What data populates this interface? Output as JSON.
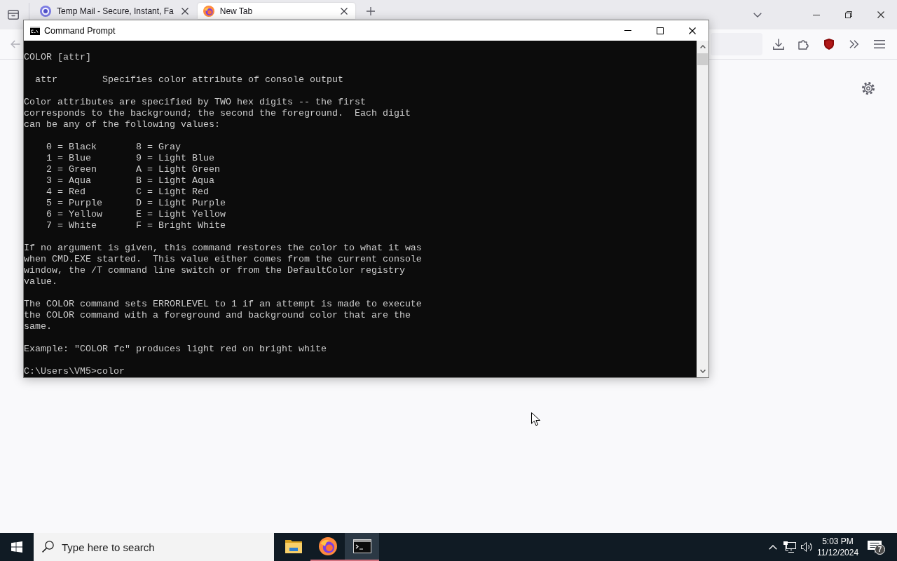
{
  "browser": {
    "tabs": [
      {
        "kind": "site",
        "title": "Temp Mail - Secure, Instant, Fa",
        "selected": false
      },
      {
        "kind": "browser",
        "title": "New Tab",
        "selected": true
      }
    ],
    "back_button": {
      "disabled": true
    }
  },
  "window": {
    "title": "Command Prompt",
    "console": [
      {
        "kind": "text",
        "lines": [
          "COLOR [attr]"
        ]
      },
      {
        "kind": "parameter",
        "name": "attr",
        "description": "Specifies color attribute of console output"
      },
      {
        "kind": "text",
        "lines": [
          "Color attributes are specified by TWO hex digits -- the first",
          "corresponds to the background; the second the foreground.  Each digit",
          "can be any of the following values:"
        ]
      },
      {
        "kind": "table",
        "rows": [
          [
            "0 = Black",
            "8 = Gray"
          ],
          [
            "1 = Blue",
            "9 = Light Blue"
          ],
          [
            "2 = Green",
            "A = Light Green"
          ],
          [
            "3 = Aqua",
            "B = Light Aqua"
          ],
          [
            "4 = Red",
            "C = Light Red"
          ],
          [
            "5 = Purple",
            "D = Light Purple"
          ],
          [
            "6 = Yellow",
            "E = Light Yellow"
          ],
          [
            "7 = White",
            "F = Bright White"
          ]
        ]
      },
      {
        "kind": "text",
        "lines": [
          "If no argument is given, this command restores the color to what it was",
          "when CMD.EXE started.  This value either comes from the current console",
          "window, the /T command line switch or from the DefaultColor registry",
          "value."
        ]
      },
      {
        "kind": "text",
        "lines": [
          "The COLOR command sets ERRORLEVEL to 1 if an attempt is made to execute",
          "the COLOR command with a foreground and background color that are the",
          "same."
        ]
      },
      {
        "kind": "text",
        "lines": [
          "Example: \"COLOR fc\" produces light red on bright white"
        ]
      },
      {
        "kind": "text",
        "lines": [
          "C:\\Users\\VM5>color"
        ]
      }
    ]
  },
  "taskbar": {
    "search": {
      "placeholder": "Type here to search"
    },
    "apps": [
      {
        "kind": "folder",
        "running": false,
        "selected": false
      },
      {
        "kind": "browser",
        "running": true,
        "selected": false
      },
      {
        "kind": "terminal",
        "running": true,
        "selected": true
      }
    ],
    "clock": {
      "time": "5:03 PM",
      "date": "11/12/2024"
    },
    "notifications": {
      "badge": "7"
    }
  }
}
